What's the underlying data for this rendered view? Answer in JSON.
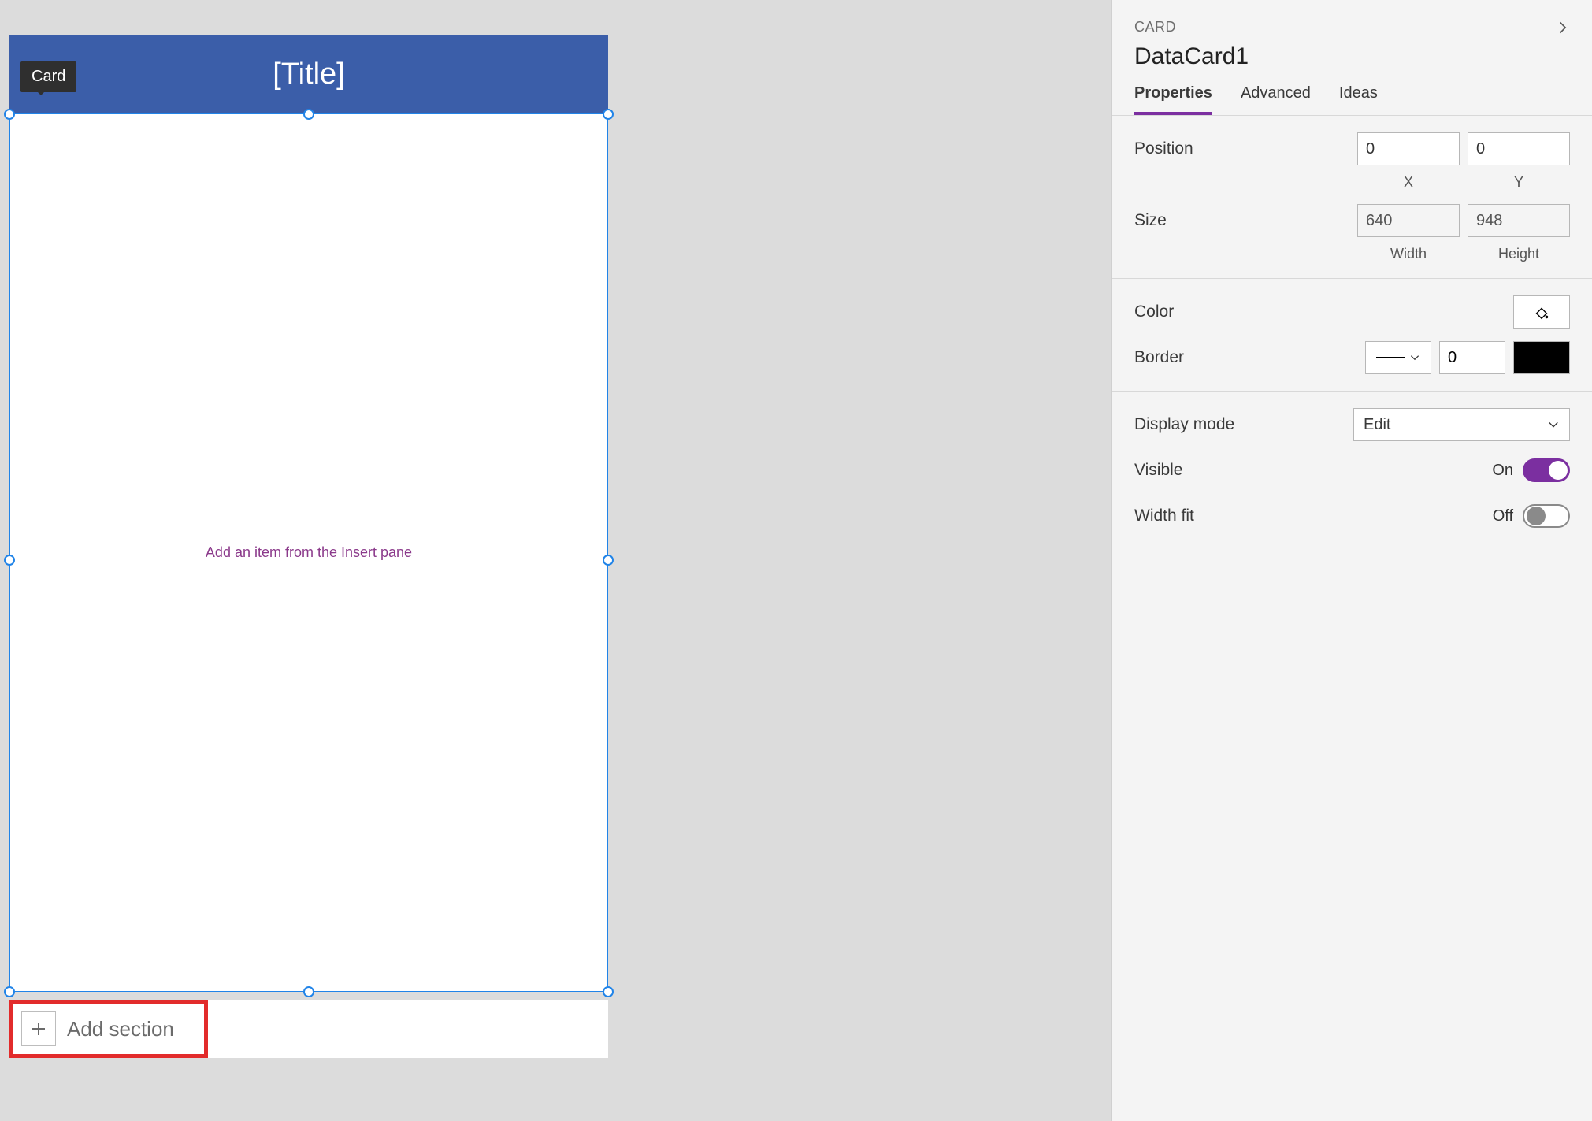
{
  "canvas": {
    "tooltip": "Card",
    "title_placeholder": "[Title]",
    "empty_hint": "Add an item from the Insert pane",
    "add_section_label": "Add section"
  },
  "panel": {
    "type_label": "CARD",
    "object_name": "DataCard1",
    "tabs": {
      "properties": "Properties",
      "advanced": "Advanced",
      "ideas": "Ideas"
    },
    "position": {
      "label": "Position",
      "x": "0",
      "y": "0",
      "x_label": "X",
      "y_label": "Y"
    },
    "size": {
      "label": "Size",
      "width": "640",
      "height": "948",
      "width_label": "Width",
      "height_label": "Height"
    },
    "color": {
      "label": "Color"
    },
    "border": {
      "label": "Border",
      "width": "0",
      "color": "#000000"
    },
    "display_mode": {
      "label": "Display mode",
      "value": "Edit"
    },
    "visible": {
      "label": "Visible",
      "state": "On"
    },
    "width_fit": {
      "label": "Width fit",
      "state": "Off"
    }
  }
}
